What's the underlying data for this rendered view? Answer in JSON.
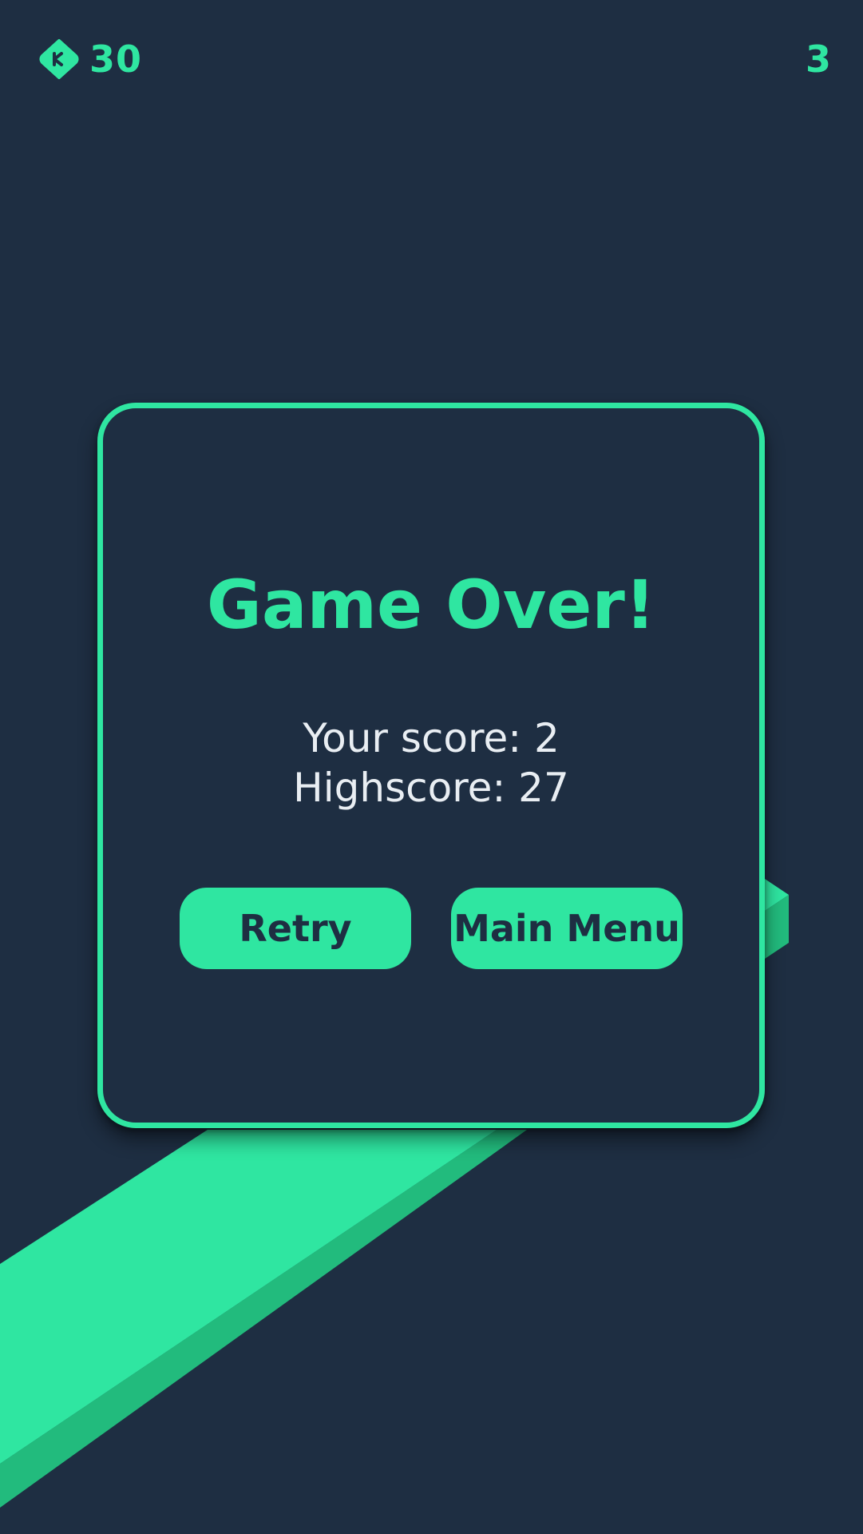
{
  "hud": {
    "gems": "30",
    "score": "3"
  },
  "panel": {
    "title": "Game Over!",
    "your_score": "Your score: 2",
    "highscore": "Highscore: 27"
  },
  "buttons": {
    "retry": "Retry",
    "main_menu": "Main Menu"
  },
  "colors": {
    "background": "#1e2e42",
    "accent": "#2fe6a1",
    "accent_shadow": "#22bb7d",
    "text_light": "#e9eef3"
  },
  "icons": {
    "gem": "gem-icon"
  }
}
